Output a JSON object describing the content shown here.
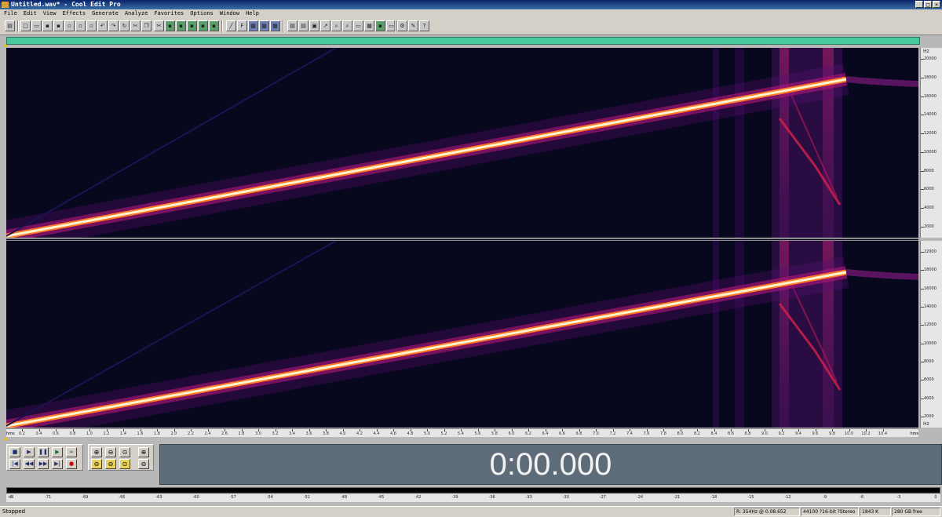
{
  "window": {
    "title": "Untitled.wav* - Cool Edit Pro",
    "buttons": [
      "_",
      "□",
      "×"
    ]
  },
  "menu": [
    "File",
    "Edit",
    "View",
    "Effects",
    "Generate",
    "Analyze",
    "Favorites",
    "Options",
    "Window",
    "Help"
  ],
  "freq_ruler": {
    "unit": "Hz",
    "labels_ch1": [
      "20000",
      "18000",
      "16000",
      "14000",
      "12000",
      "10000",
      "8000",
      "6000",
      "4000",
      "2000"
    ],
    "labels_ch2": [
      "22000",
      "18000",
      "16000",
      "14000",
      "12000",
      "10000",
      "8000",
      "6000",
      "4000",
      "2000"
    ]
  },
  "time_ruler": {
    "left_unit": "hms",
    "right_unit": "hms",
    "labels": [
      "0.2",
      "0.4",
      "0.6",
      "0.8",
      "1.0",
      "1.2",
      "1.4",
      "1.6",
      "1.8",
      "2.0",
      "2.2",
      "2.4",
      "2.6",
      "2.8",
      "3.0",
      "3.2",
      "3.4",
      "3.6",
      "3.8",
      "4.0",
      "4.2",
      "4.4",
      "4.6",
      "4.8",
      "5.0",
      "5.2",
      "5.4",
      "5.6",
      "5.8",
      "6.0",
      "6.2",
      "6.4",
      "6.6",
      "6.8",
      "7.0",
      "7.2",
      "7.4",
      "7.6",
      "7.8",
      "8.0",
      "8.2",
      "8.4",
      "8.6",
      "8.8",
      "9.0",
      "9.2",
      "9.4",
      "9.6",
      "9.8",
      "10.0",
      "10.2",
      "10.4"
    ]
  },
  "transport": {
    "row1": [
      "■",
      "▶",
      "❚❚",
      "▶",
      "∞"
    ],
    "row2": [
      "|◀",
      "◀◀",
      "▶▶",
      "▶|",
      "●"
    ]
  },
  "time_display": "0:00.000",
  "level_meter": {
    "labels": [
      "dB",
      "-71",
      "-69",
      "-66",
      "-63",
      "-60",
      "-57",
      "-54",
      "-51",
      "-48",
      "-45",
      "-42",
      "-39",
      "-36",
      "-33",
      "-30",
      "-27",
      "-24",
      "-21",
      "-18",
      "-15",
      "-12",
      "-9",
      "-6",
      "-3",
      "0"
    ]
  },
  "status": {
    "state": "Stopped",
    "cursor": "R: 354Hz @  0.08.652",
    "format": "44100 ?16-bit ?Stereo",
    "size": "1843 K",
    "free": "280 GB free"
  },
  "colors": {
    "spectrogram_bg": "#07071e",
    "sweep_core": "#fff6d0",
    "sweep_glow": "#ff7a2a",
    "overview": "#48c89e",
    "time_display_bg": "#5e6b78"
  }
}
